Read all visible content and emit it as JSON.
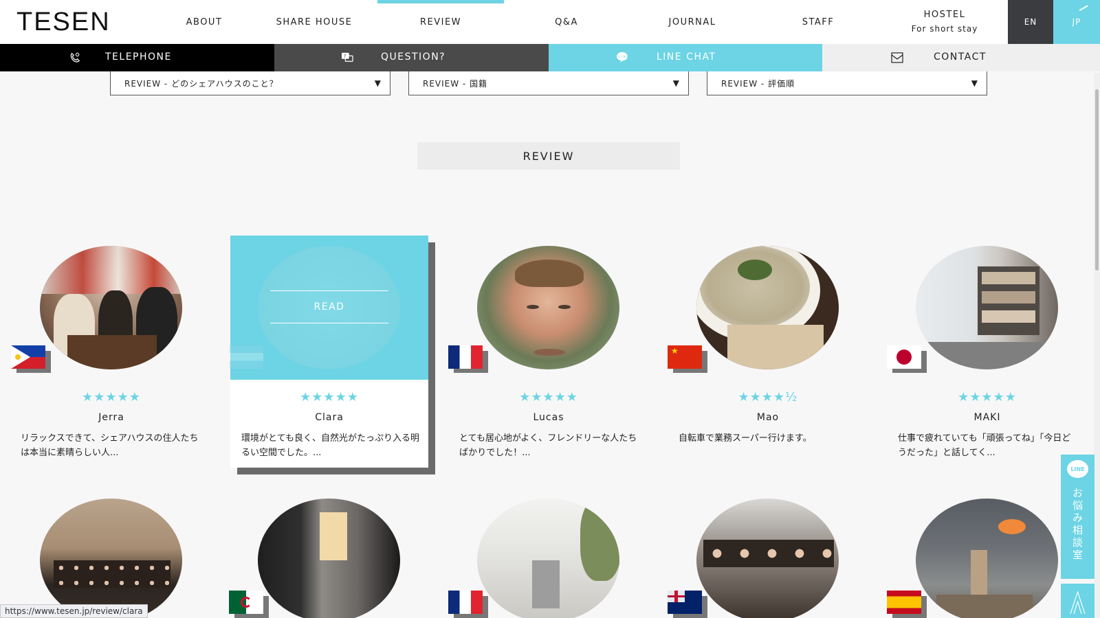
{
  "header": {
    "logo": "TESEN",
    "nav": [
      {
        "label": "ABOUT"
      },
      {
        "label": "SHARE HOUSE"
      },
      {
        "label": "REVIEW"
      },
      {
        "label": "Q&A"
      },
      {
        "label": "JOURNAL"
      },
      {
        "label": "STAFF"
      }
    ],
    "hostel": {
      "label": "HOSTEL",
      "sub": "For short stay"
    },
    "lang": {
      "en": "EN",
      "jp": "JP"
    }
  },
  "contact_bar": {
    "telephone": "TELEPHONE",
    "question": "QUESTION?",
    "line_chat": "LINE CHAT",
    "contact": "CONTACT"
  },
  "filters": [
    {
      "label": "REVIEW - どのシェアハウスのこと？"
    },
    {
      "label": "REVIEW - 国籍"
    },
    {
      "label": "REVIEW - 評価順"
    }
  ],
  "section_title": "REVIEW",
  "read_label": "READ",
  "reviews": [
    {
      "name": "Jerra",
      "stars": "★★★★★",
      "excerpt": "リラックスできて、シェアハウスの住人たちは本当に素晴らしい人...",
      "flag": "philippines"
    },
    {
      "name": "Clara",
      "stars": "★★★★★",
      "excerpt": "環境がとても良く、自然光がたっぷり入る明るい空間でした。...",
      "flag": "argentina"
    },
    {
      "name": "Lucas",
      "stars": "★★★★★",
      "excerpt": "とても居心地がよく、フレンドリーな人たちばかりでした！...",
      "flag": "france"
    },
    {
      "name": "Mao",
      "stars": "★★★★½",
      "excerpt": "自転車で業務スーパー行けます。",
      "flag": "china"
    },
    {
      "name": "MAKI",
      "stars": "★★★★★",
      "excerpt": "仕事で疲れていても「頑張ってね」「今日どうだった」と話してく...",
      "flag": "japan"
    }
  ],
  "second_row_flags": [
    "unknown",
    "algeria",
    "france",
    "new-zealand",
    "spain"
  ],
  "side": {
    "line_badge": "LINE",
    "consult": "お悩み相談室"
  },
  "status_url": "https://www.tesen.jp/review/clara",
  "colors": {
    "accent": "#6cd4e4",
    "dark": "#3b3c3f"
  }
}
